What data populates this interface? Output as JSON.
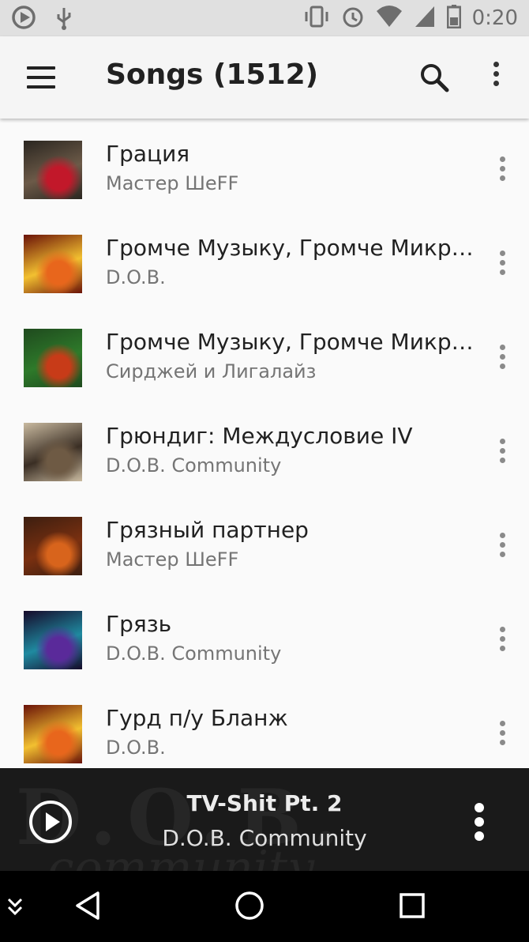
{
  "status_bar": {
    "time": "0:20",
    "icons": [
      "play-store-icon",
      "usb-icon",
      "vibrate-icon",
      "alarm-icon",
      "wifi-icon",
      "signal-icon",
      "battery-icon"
    ]
  },
  "toolbar": {
    "title": "Songs (1512)",
    "icons": [
      "menu-icon",
      "search-icon",
      "more-vert-icon"
    ]
  },
  "songs": [
    {
      "title": "Грация",
      "artist": "Мастер ШеFF",
      "art_colors": [
        "#2a2620",
        "#c2182a",
        "#6c5a48"
      ]
    },
    {
      "title": "Громче Музыку, Громче Микрофоны!",
      "artist": "D.O.B.",
      "art_colors": [
        "#6a1208",
        "#e8661c",
        "#f2c030"
      ]
    },
    {
      "title": "Громче Музыку, Громче Микрофоны!",
      "artist": "Сирджей и Лигалайз",
      "art_colors": [
        "#1f4a1e",
        "#c83b18",
        "#2e7a2a"
      ]
    },
    {
      "title": "Грюндиг: Междусловие IV",
      "artist": "D.O.B. Community",
      "art_colors": [
        "#c9baa0",
        "#6e5a44",
        "#3a2e24"
      ]
    },
    {
      "title": "Грязный партнер",
      "artist": "Мастер ШеFF",
      "art_colors": [
        "#3c1e10",
        "#d8641c",
        "#7a3010"
      ]
    },
    {
      "title": "Грязь",
      "artist": "D.O.B. Community",
      "art_colors": [
        "#160a2a",
        "#5a2a9a",
        "#1f8aa0"
      ]
    },
    {
      "title": "Гурд п/у Бланж",
      "artist": "D.O.B.",
      "art_colors": [
        "#6a1208",
        "#e8661c",
        "#f2c030"
      ]
    }
  ],
  "now_playing": {
    "title": "TV-Shit Pt. 2",
    "artist": "D.O.B. Community",
    "bg_text_1": "D.O.B.",
    "bg_text_2": "community"
  },
  "nav_bar": {
    "icons": [
      "collapse-icon",
      "back-icon",
      "home-icon",
      "recents-icon"
    ]
  }
}
